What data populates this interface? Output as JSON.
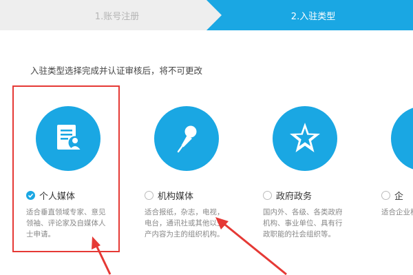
{
  "steps": [
    {
      "label": "1.账号注册",
      "state": "done"
    },
    {
      "label": "2.入驻类型",
      "state": "active"
    }
  ],
  "notice": "入驻类型选择完成并认证审核后，将不可更改",
  "accent_color": "#1aa7e3",
  "highlight_color": "#e53935",
  "cards": [
    {
      "icon": "document-user-icon",
      "label": "个人媒体",
      "selected": true,
      "desc": "适合垂直领域专家、意见领袖、评论家及自媒体人士申请。"
    },
    {
      "icon": "microphone-icon",
      "label": "机构媒体",
      "selected": false,
      "desc": "适合报纸，杂志，电视，电台，通讯社或其他以生产内容为主的组织机构。"
    },
    {
      "icon": "star-icon",
      "label": "政府政务",
      "selected": false,
      "desc": "国内外、各级、各类政府机构、事业单位、具有行政职能的社会组织等。"
    },
    {
      "icon": "building-icon",
      "label": "企",
      "selected": false,
      "desc": "适合企业机构，产品与服"
    }
  ]
}
